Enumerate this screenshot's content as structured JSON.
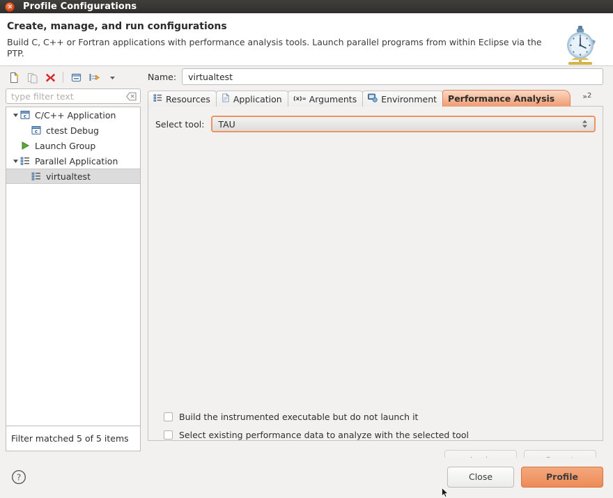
{
  "window": {
    "title": "Profile Configurations",
    "close_icon": "window-close-icon"
  },
  "header": {
    "title": "Create, manage, and run configurations",
    "description": "Build C, C++ or Fortran applications with performance analysis tools.  Launch parallel programs from within Eclipse via the PTP.",
    "icon": "stopwatch-icon"
  },
  "left_panel": {
    "toolbar": [
      {
        "name": "new-configuration-icon",
        "tooltip": "New launch configuration"
      },
      {
        "name": "duplicate-configuration-icon",
        "tooltip": "Duplicate"
      },
      {
        "name": "delete-configuration-icon",
        "tooltip": "Delete"
      },
      {
        "name": "collapse-all-icon",
        "tooltip": "Collapse All"
      },
      {
        "name": "filter-icon",
        "tooltip": "Filter"
      },
      {
        "name": "view-menu-icon",
        "tooltip": "View Menu"
      }
    ],
    "filter": {
      "placeholder": "type filter text",
      "value": "",
      "clear_icon": "clear-icon"
    },
    "tree": [
      {
        "label": "C/C++ Application",
        "icon": "c-application-icon",
        "level": 0,
        "expanded": true,
        "selected": false
      },
      {
        "label": "ctest Debug",
        "icon": "c-application-icon",
        "level": 1,
        "expanded": null,
        "selected": false
      },
      {
        "label": "Launch Group",
        "icon": "launch-group-icon",
        "level": 0,
        "expanded": null,
        "selected": false
      },
      {
        "label": "Parallel Application",
        "icon": "parallel-application-icon",
        "level": 0,
        "expanded": true,
        "selected": false
      },
      {
        "label": "virtualtest",
        "icon": "parallel-application-icon",
        "level": 1,
        "expanded": null,
        "selected": true
      }
    ],
    "status": "Filter matched 5 of 5 items"
  },
  "right_panel": {
    "name_label": "Name:",
    "name_value": "virtualtest",
    "name_placeholder": "",
    "tabs": [
      {
        "label": "Resources",
        "icon": "resources-icon",
        "active": false
      },
      {
        "label": "Application",
        "icon": "application-icon",
        "active": false
      },
      {
        "label": "Arguments",
        "icon": "arguments-icon",
        "active": false
      },
      {
        "label": "Environment",
        "icon": "environment-icon",
        "active": false
      },
      {
        "label": "Performance Analysis",
        "icon": "",
        "active": true
      }
    ],
    "tab_overflow": {
      "symbol": "»",
      "count": "2"
    },
    "performance_analysis": {
      "select_tool_label": "Select tool:",
      "select_tool_value": "TAU",
      "checkboxes": [
        {
          "label": "Build the instrumented executable but do not launch it",
          "checked": false
        },
        {
          "label": "Select existing performance data to analyze with the selected tool",
          "checked": false
        }
      ]
    },
    "apply_label": "Apply",
    "apply_enabled": false,
    "revert_label": "Revert",
    "revert_enabled": false
  },
  "footer": {
    "help_icon": "help-icon",
    "close_label": "Close",
    "profile_label": "Profile"
  },
  "colors": {
    "accent_orange": "#ee9163",
    "active_tab_top": "#fbd9c4",
    "active_tab_bottom": "#f09b72",
    "titlebar": "#383633",
    "panel_bg": "#f2f1f0",
    "selection": "#dcdcdc"
  }
}
